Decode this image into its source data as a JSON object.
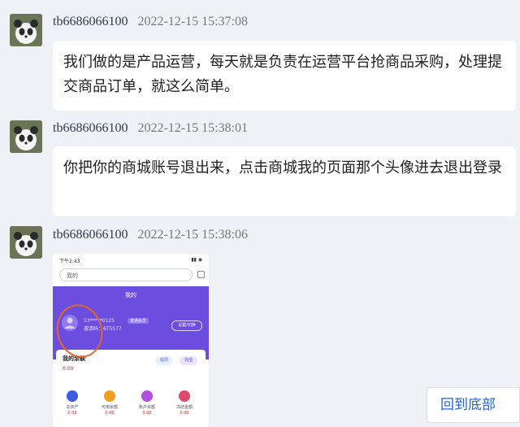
{
  "messages": [
    {
      "user_id": "tb6686066100",
      "timestamp": "2022-12-15 15:37:08",
      "text": "我们做的是产品运营，每天就是负责在运营平台抢商品采购，处理提交商品订单，就这么简单。"
    },
    {
      "user_id": "tb6686066100",
      "timestamp": "2022-12-15 15:38:01",
      "text": "你把你的商城账号退出来，点击商城我的页面那个头像进去退出登录"
    },
    {
      "user_id": "tb6686066100",
      "timestamp": "2022-12-15 15:38:06",
      "image": {
        "status_time": "下午2:43",
        "search_text": "我的",
        "header_title": "我的",
        "account_line1": "13*****0125",
        "account_tag": "普通会员",
        "account_line2": "邀请码：6T5S77",
        "settings_button": "设置/切换",
        "balance_label": "我的余额",
        "balance_value": "0.00",
        "btn_withdraw": "提现",
        "btn_recharge": "充值",
        "shortcuts": [
          {
            "label": "总资产",
            "value": "0.00",
            "color": "#3b5fe0"
          },
          {
            "label": "可用余额",
            "value": "0.00",
            "color": "#f0a020"
          },
          {
            "label": "账户余额",
            "value": "0.00",
            "color": "#b04fe0"
          },
          {
            "label": "冻结金额",
            "value": "0.00",
            "color": "#e04a6a"
          }
        ]
      }
    }
  ],
  "back_to_bottom": "回到底部",
  "colors": {
    "accent_blue": "#2563d8",
    "phone_header": "#6b4ee0",
    "mark": "#e3662c"
  }
}
